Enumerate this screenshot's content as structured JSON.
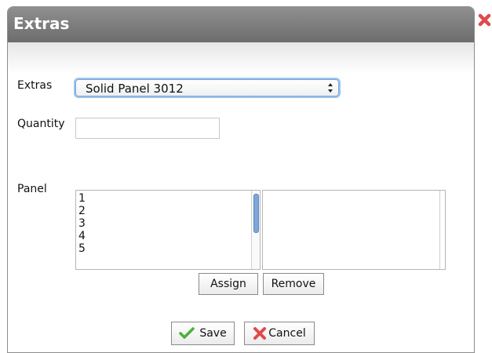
{
  "dialog": {
    "title": "Extras",
    "close_icon": "close-icon",
    "accent_color": "#e04a4a",
    "titlebar_color": "#7d7d7d"
  },
  "form": {
    "extras_label": "Extras",
    "extras_selected": "Solid Panel 3012",
    "quantity_label": "Quantity",
    "quantity_value": "",
    "panel_label": "Panel",
    "panel_available": [
      "1",
      "2",
      "3",
      "4",
      "5"
    ],
    "panel_assigned": [],
    "assign_label": "Assign",
    "remove_label": "Remove"
  },
  "footer": {
    "save_label": "Save",
    "save_icon": "checkmark-icon",
    "cancel_label": "Cancel",
    "cancel_icon": "x-icon"
  }
}
